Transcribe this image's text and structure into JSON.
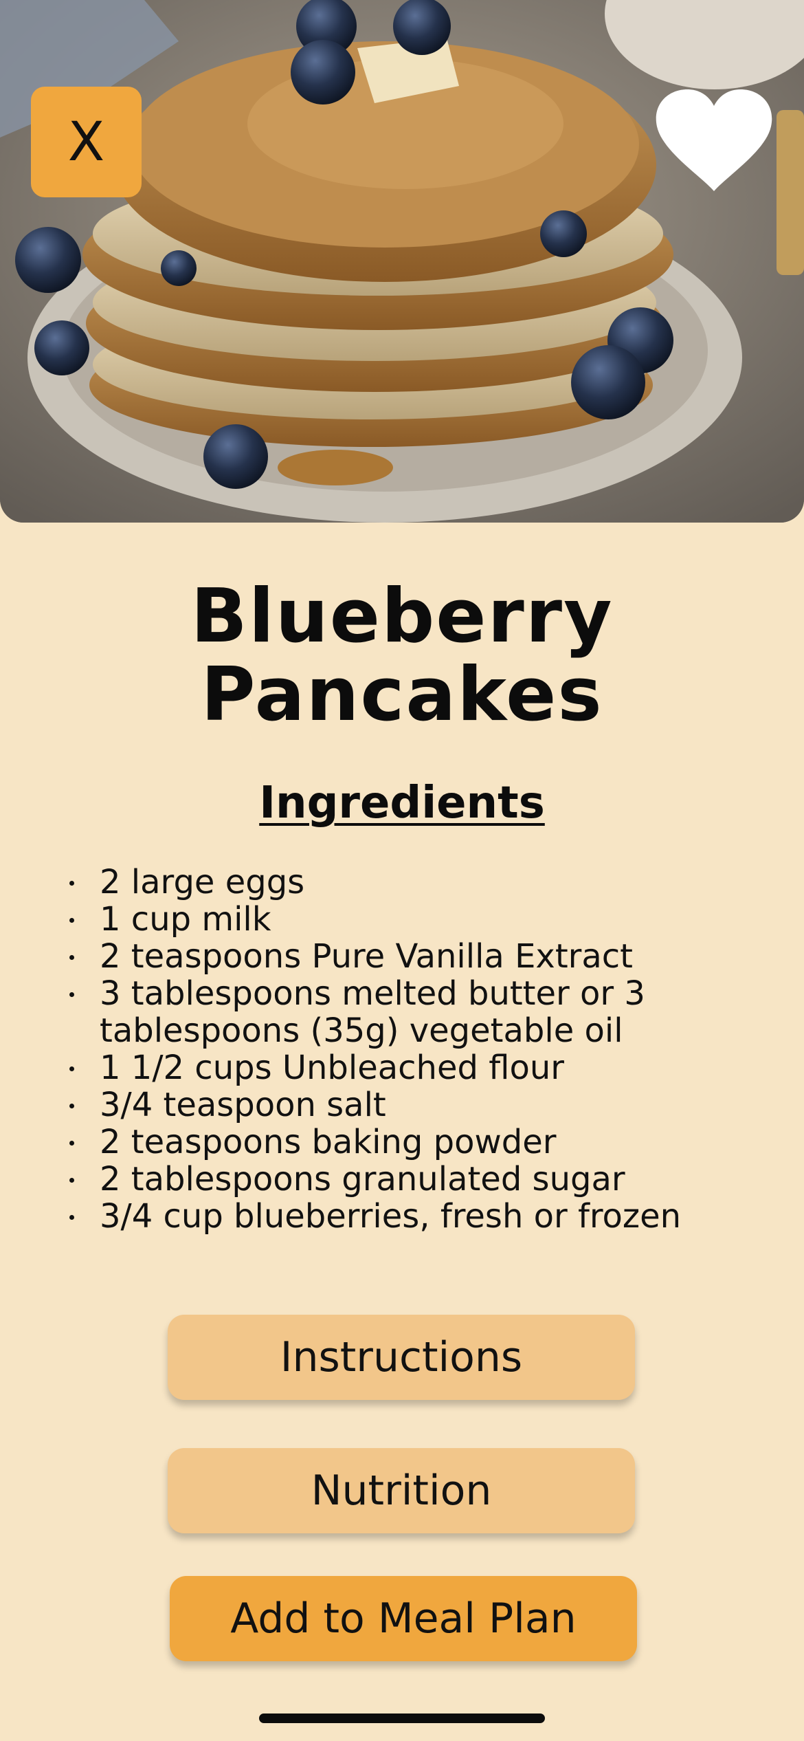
{
  "app": {
    "close_label": "X"
  },
  "recipe": {
    "title_line1": "Blueberry",
    "title_line2": "Pancakes",
    "ingredients_heading": "Ingredients",
    "ingredients": [
      "2 large eggs",
      "1 cup milk",
      "2 teaspoons Pure Vanilla Extract",
      "3 tablespoons melted butter or 3 tablespoons (35g) vegetable oil",
      "1 1/2 cups Unbleached flour",
      "3/4 teaspoon salt",
      "2 teaspoons baking powder",
      "2 tablespoons granulated sugar",
      "3/4 cup blueberries, fresh or frozen"
    ]
  },
  "actions": {
    "instructions_label": "Instructions",
    "nutrition_label": "Nutrition",
    "meal_plan_label": "Add to Meal Plan"
  },
  "icons": {
    "close": "close-icon",
    "favorite": "heart-icon"
  },
  "colors": {
    "background": "#f7e5c5",
    "accent": "#f0a73e",
    "button_light": "#f2c68a",
    "text": "#0c0c0c"
  }
}
